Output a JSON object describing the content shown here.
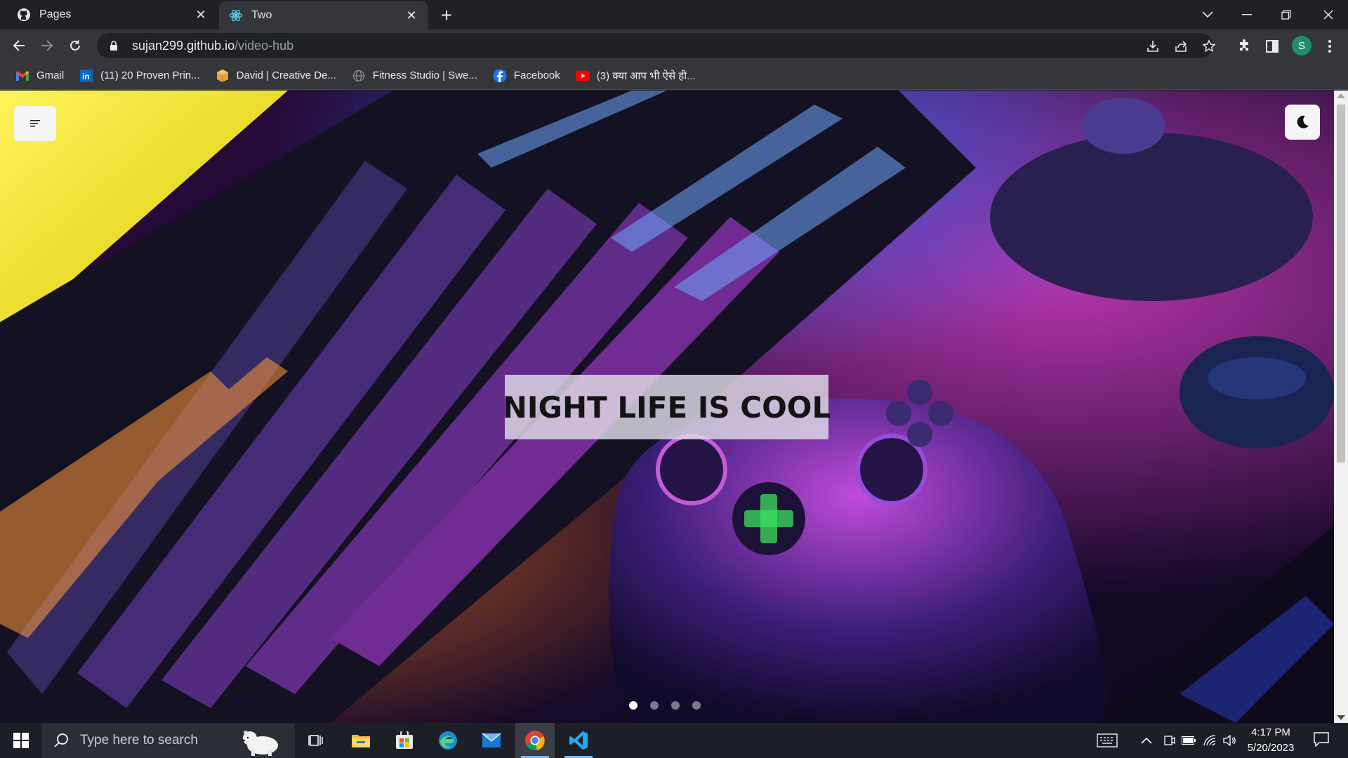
{
  "browser": {
    "tabs": [
      {
        "title": "Pages",
        "icon": "github-icon",
        "active": false
      },
      {
        "title": "Two",
        "icon": "react-icon",
        "active": true
      }
    ],
    "new_tab_label": "+",
    "window_controls": [
      "tab-search",
      "minimize",
      "restore",
      "close"
    ],
    "url_host": "sujan299.github.io",
    "url_path": "/video-hub",
    "profile_initial": "S",
    "bookmarks": [
      {
        "label": "Gmail",
        "icon": "gmail-icon"
      },
      {
        "label": "(11) 20 Proven Prin...",
        "icon": "linkedin-icon"
      },
      {
        "label": "David | Creative De...",
        "icon": "box-icon"
      },
      {
        "label": "Fitness Studio | Swe...",
        "icon": "globe-icon"
      },
      {
        "label": "Facebook",
        "icon": "facebook-icon"
      },
      {
        "label": "(3) क्या आप भी ऐसे ही...",
        "icon": "youtube-icon"
      }
    ]
  },
  "page": {
    "hero_title": "NIGHT LIFE IS COOL",
    "carousel": {
      "slides": 4,
      "active_index": 0
    },
    "menu_icon": "menu-lines-icon",
    "theme_icon": "moon-icon"
  },
  "taskbar": {
    "search_placeholder": "Type here to search",
    "apps": [
      "task-view-icon",
      "file-explorer-icon",
      "microsoft-store-icon",
      "edge-icon",
      "mail-icon",
      "chrome-icon",
      "vscode-icon"
    ],
    "time": "4:17 PM",
    "date": "5/20/2023"
  },
  "colors": {
    "browser_frame": "#202124",
    "toolbar": "#35363a",
    "taskbar": "#1c1f26",
    "accent_pink": "#e040c0",
    "accent_blue": "#3c50ff"
  }
}
